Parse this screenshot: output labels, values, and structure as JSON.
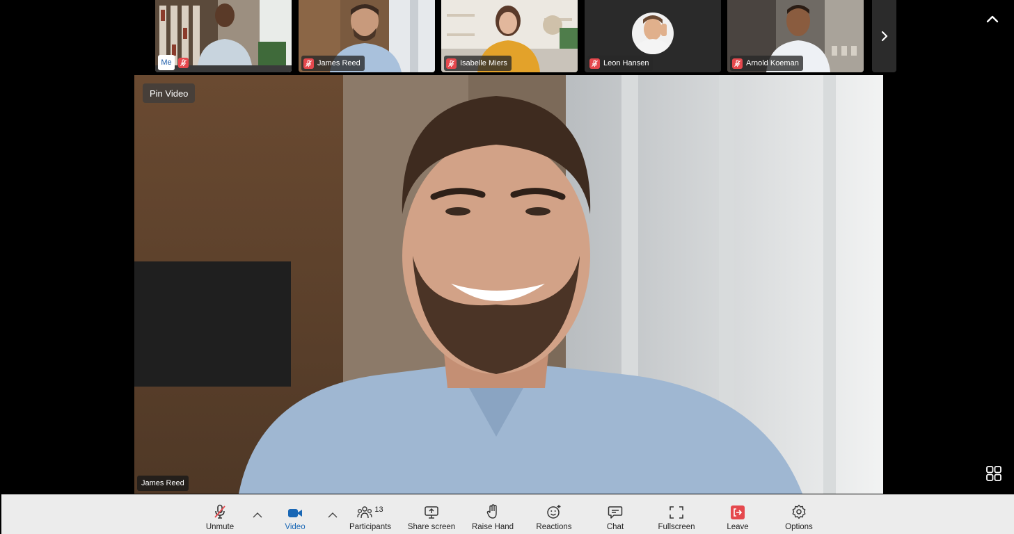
{
  "thumbnails": [
    {
      "name": "",
      "me_label": "Me",
      "is_self": true,
      "muted": true
    },
    {
      "name": "James Reed",
      "muted": true
    },
    {
      "name": "Isabelle Miers",
      "muted": true
    },
    {
      "name": "Leon Hansen",
      "muted": true,
      "avatar_only": true
    },
    {
      "name": "Arnold Koeman",
      "muted": true
    }
  ],
  "main_video": {
    "pin_label": "Pin Video",
    "speaker_name": "James Reed"
  },
  "toolbar": {
    "unmute": "Unmute",
    "video": "Video",
    "participants": "Participants",
    "participants_count": "13",
    "share_screen": "Share screen",
    "raise_hand": "Raise Hand",
    "reactions": "Reactions",
    "chat": "Chat",
    "fullscreen": "Fullscreen",
    "leave": "Leave",
    "options": "Options"
  },
  "icons": {
    "unmute": "mic-off-icon",
    "video": "video-camera-icon",
    "participants": "participants-icon",
    "share_screen": "share-screen-icon",
    "raise_hand": "hand-icon",
    "reactions": "smile-icon",
    "chat": "chat-bubble-icon",
    "fullscreen": "fullscreen-icon",
    "leave": "leave-icon",
    "options": "gear-icon"
  },
  "colors": {
    "accent": "#1967b5",
    "mute_red": "#e5484d",
    "toolbar_bg": "#ececec"
  }
}
